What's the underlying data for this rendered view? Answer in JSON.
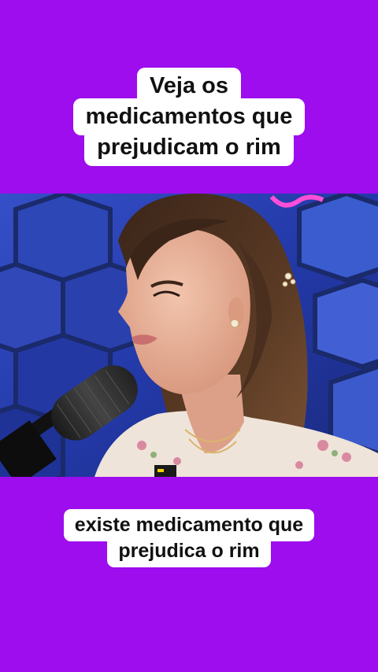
{
  "overlay_top": {
    "lines": [
      "Veja os",
      "medicamentos que",
      "prejudicam o rim"
    ]
  },
  "subtitle": {
    "lines": [
      "existe medicamento que",
      "prejudica o rim"
    ]
  },
  "colors": {
    "background": "#9d0ded",
    "caption_bg": "#ffffff",
    "caption_text": "#111111",
    "studio_blue": "#1b2e8a"
  },
  "video": {
    "description_icon": "speaker-with-microphone"
  }
}
